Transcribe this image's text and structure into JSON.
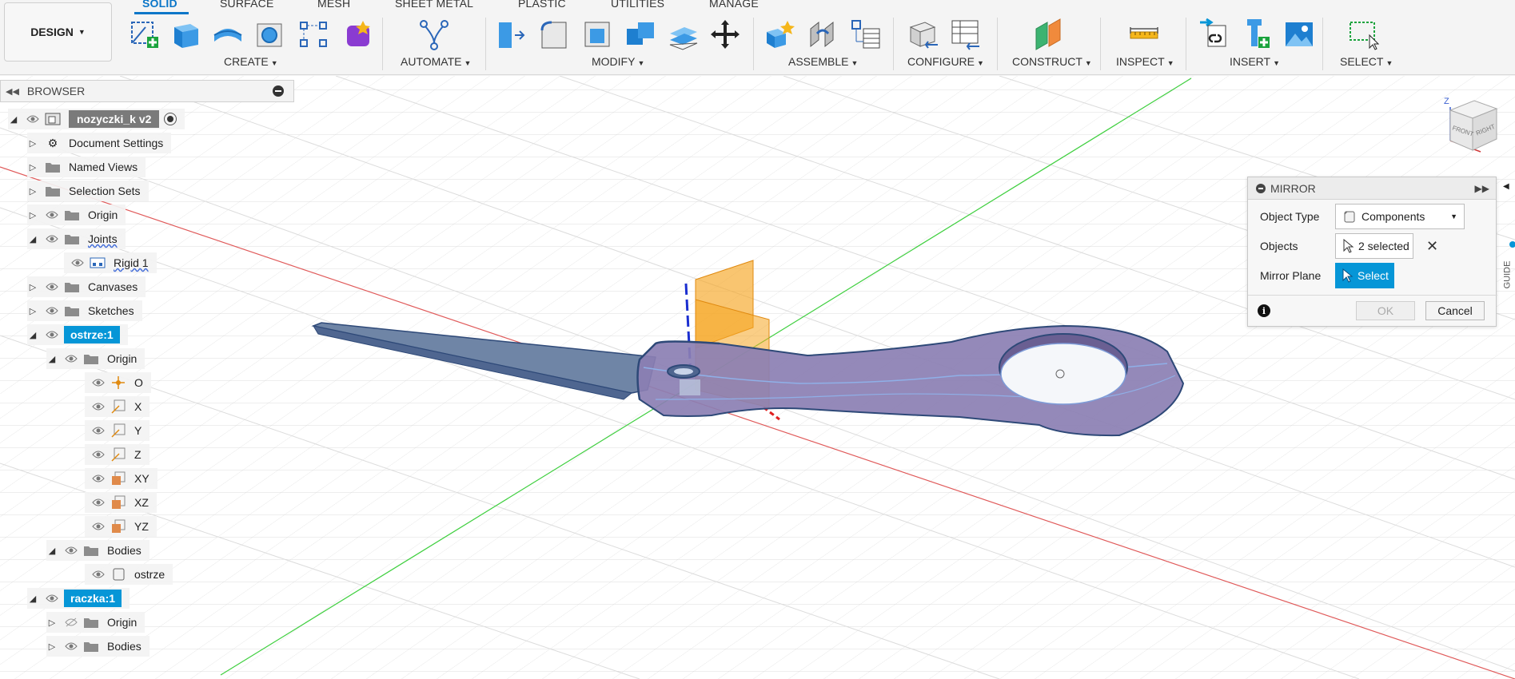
{
  "toolbar": {
    "workspace_label": "DESIGN",
    "tabs": [
      "SOLID",
      "SURFACE",
      "MESH",
      "SHEET METAL",
      "PLASTIC",
      "UTILITIES",
      "MANAGE"
    ],
    "groups": [
      "CREATE",
      "AUTOMATE",
      "MODIFY",
      "ASSEMBLE",
      "CONFIGURE",
      "CONSTRUCT",
      "INSPECT",
      "INSERT",
      "SELECT"
    ]
  },
  "browser": {
    "title": "BROWSER",
    "root": "nozyczki_k v2",
    "items": [
      {
        "label": "Document Settings"
      },
      {
        "label": "Named Views"
      },
      {
        "label": "Selection Sets"
      },
      {
        "label": "Origin"
      },
      {
        "label": "Joints"
      },
      {
        "label": "Rigid 1"
      },
      {
        "label": "Canvases"
      },
      {
        "label": "Sketches"
      },
      {
        "label": "ostrze:1"
      },
      {
        "label": "Origin"
      },
      {
        "label": "O"
      },
      {
        "label": "X"
      },
      {
        "label": "Y"
      },
      {
        "label": "Z"
      },
      {
        "label": "XY"
      },
      {
        "label": "XZ"
      },
      {
        "label": "YZ"
      },
      {
        "label": "Bodies"
      },
      {
        "label": "ostrze"
      },
      {
        "label": "raczka:1"
      },
      {
        "label": "Origin"
      },
      {
        "label": "Bodies"
      }
    ]
  },
  "mirror": {
    "title": "MIRROR",
    "object_type_label": "Object Type",
    "object_type_value": "Components",
    "objects_label": "Objects",
    "objects_value": "2 selected",
    "mirror_plane_label": "Mirror Plane",
    "mirror_plane_value": "Select",
    "ok_label": "OK",
    "cancel_label": "Cancel"
  },
  "viewcube": {
    "front_label": "FRONT",
    "right_label": "RIGHT",
    "z_label": "Z"
  },
  "side_tab_label": "GUIDE",
  "colors": {
    "accent": "#0696d7",
    "plane": "#f6a623",
    "body": "#8b7fb3",
    "blade": "#6f85a6"
  }
}
